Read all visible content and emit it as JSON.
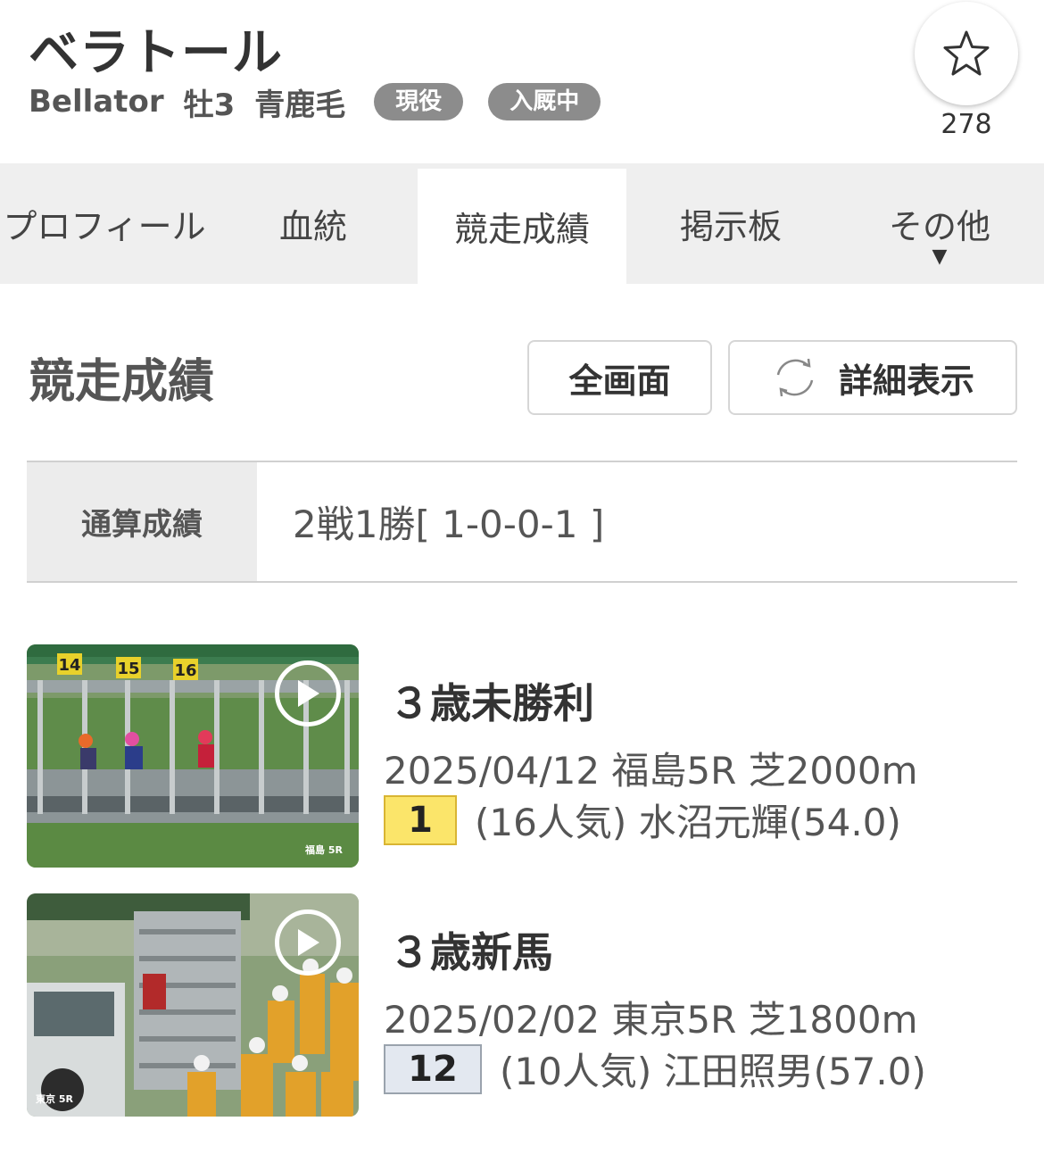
{
  "header": {
    "name": "ベラトール",
    "english_name": "Bellator",
    "sex_age": "牡3",
    "coat": "青鹿毛",
    "badges": [
      "現役",
      "入厩中"
    ],
    "favorite_icon": "star-icon",
    "favorite_count": "278"
  },
  "tabs": [
    {
      "label": "プロフィール"
    },
    {
      "label": "血統"
    },
    {
      "label": "競走成績",
      "active": true
    },
    {
      "label": "掲示板"
    },
    {
      "label": "その他",
      "caret": "▼"
    }
  ],
  "section": {
    "title": "競走成績",
    "fullscreen_label": "全画面",
    "detail_label": "詳細表示",
    "detail_icon": "refresh-icon"
  },
  "summary": {
    "label": "通算成績",
    "value": "2戦1勝[ 1-0-0-1 ]"
  },
  "races": [
    {
      "title": "３歳未勝利",
      "info": "2025/04/12 福島5R 芝2000m",
      "rank": "1",
      "detail": "(16人気) 水沼元輝(54.0)",
      "thumb_caption": "福島 5R",
      "gate_numbers": [
        "14",
        "15",
        "16"
      ],
      "rank_color": "#fbe56a"
    },
    {
      "title": "３歳新馬",
      "info": "2025/02/02 東京5R 芝1800m",
      "rank": "12",
      "detail": "(10人気) 江田照男(57.0)",
      "thumb_caption": "東京 5R",
      "rank_color": "#e3e8f0"
    }
  ]
}
